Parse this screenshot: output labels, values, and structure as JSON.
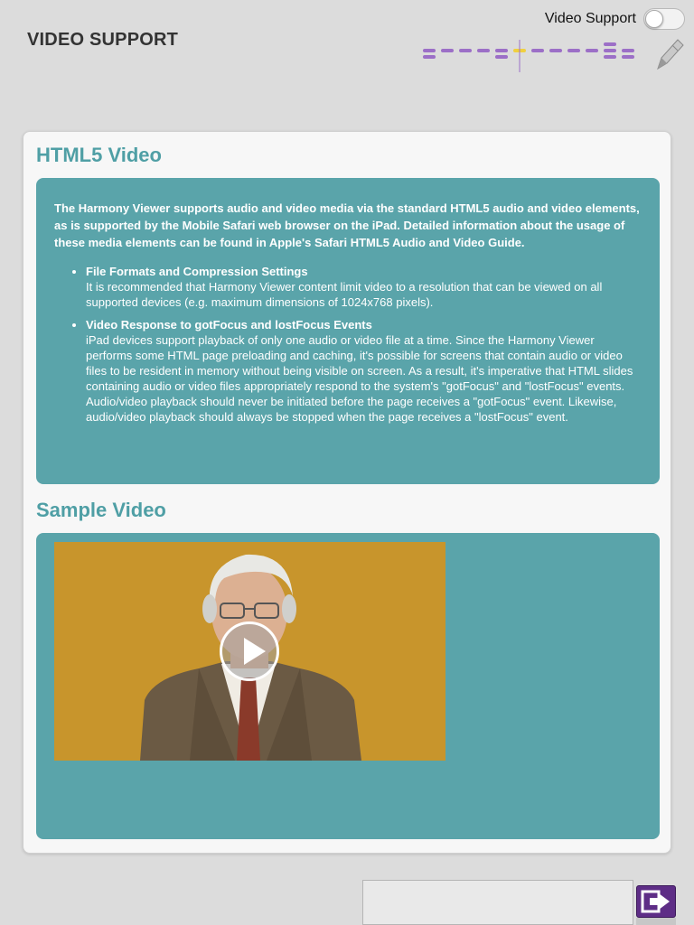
{
  "header": {
    "title": "VIDEO SUPPORT",
    "toggle_label": "Video Support",
    "toggle_on": false
  },
  "progress_nav": {
    "accent_color": "#9c6fc7",
    "current_color": "#f0d040",
    "current_index": 5
  },
  "icons": {
    "pencil": "pencil-icon",
    "play": "play-icon",
    "exit": "exit-icon"
  },
  "main": {
    "html5_heading": "HTML5 Video",
    "intro": "The Harmony Viewer supports audio and video media via the standard HTML5 audio and video elements, as is supported by the Mobile Safari web browser on the iPad. Detailed information about the usage of these media elements can be found in Apple's Safari HTML5 Audio and Video Guide.",
    "features": [
      {
        "title": "File Formats and Compression Settings",
        "body": "It is recommended that Harmony Viewer content limit video to a resolution that can be viewed on all supported devices (e.g. maximum dimensions of 1024x768 pixels)."
      },
      {
        "title": "Video Response to gotFocus and lostFocus Events",
        "body": "iPad devices support playback of only one audio or video file at a time. Since the Harmony Viewer performs some HTML page preloading and caching, it's possible for screens that contain audio or video files to be resident in memory without being visible on screen. As a result, it's imperative that HTML slides containing audio or video files appropriately respond to the system's \"gotFocus\" and \"lostFocus\" events. Audio/video playback should never be initiated before the page receives a \"gotFocus\" event. Likewise, audio/video playback should always be stopped when the page receives a \"lostFocus\" event."
      }
    ],
    "sample_heading": "Sample Video"
  },
  "colors": {
    "accent_teal": "#5aa4aa",
    "heading_teal": "#4f9fa5",
    "video_bg": "#c8952c",
    "exit_button": "#5e2d86"
  }
}
